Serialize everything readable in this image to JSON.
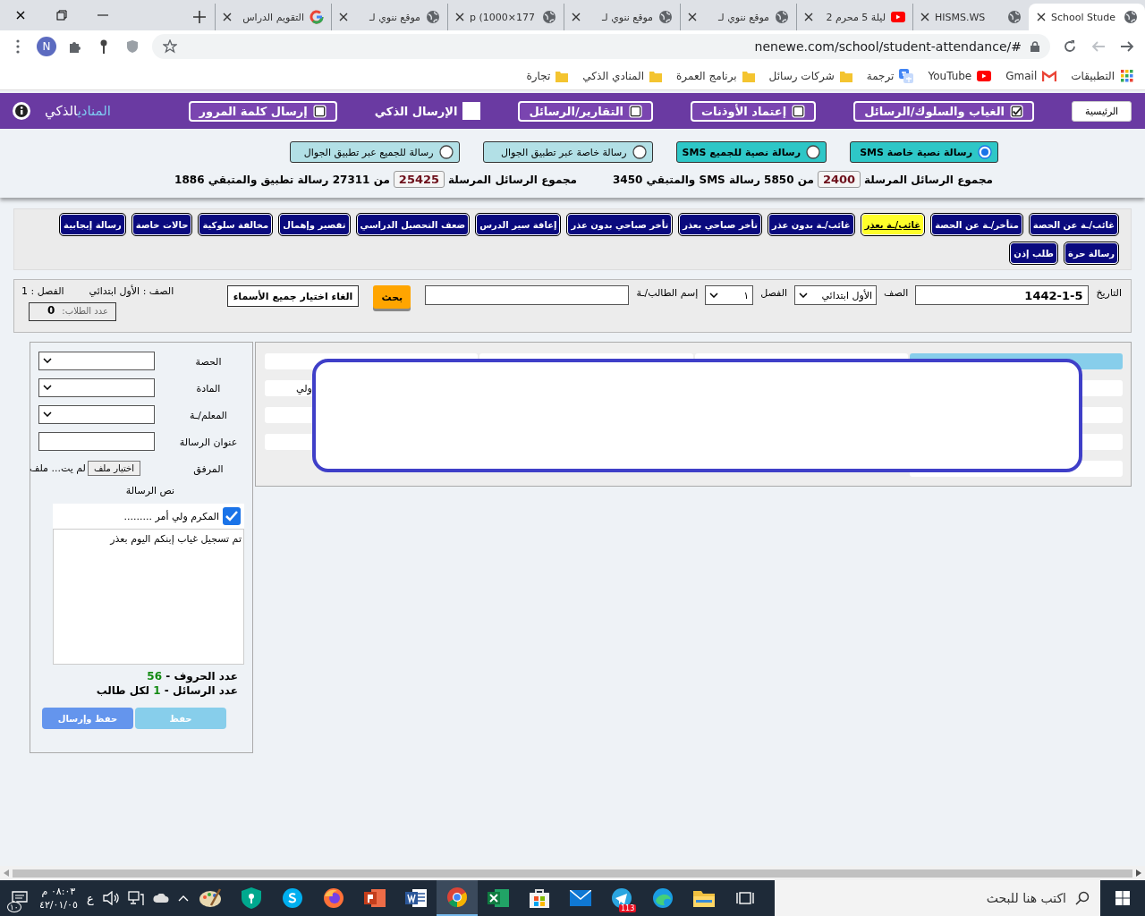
{
  "browser": {
    "tabs": [
      {
        "title": "School Stude",
        "selected": true
      },
      {
        "title": "HISMS.WS",
        "selected": false
      },
      {
        "title": "ليلة 5 محرم 2",
        "selected": false
      },
      {
        "title": "موقع ننوي لـ",
        "selected": false
      },
      {
        "title": "موقع ننوي لـ",
        "selected": false
      },
      {
        "title": "p (1000×177",
        "selected": false
      },
      {
        "title": "موقع ننوي لـ",
        "selected": false
      },
      {
        "title": "التقويم الدراس",
        "selected": false
      }
    ],
    "address": "nenewe.com/school/student-attendance/#",
    "profile_initial": "N",
    "bookmarks": [
      {
        "label": "التطبيقات"
      },
      {
        "label": "Gmail"
      },
      {
        "label": "YouTube"
      },
      {
        "label": "ترجمة"
      },
      {
        "label": "شركات رسائل"
      },
      {
        "label": "برنامج العمرة"
      },
      {
        "label": "المنادي الذكي"
      },
      {
        "label": "تجارة"
      }
    ]
  },
  "nav": {
    "home": "الرئيسية",
    "items": [
      {
        "label": "الغياب والسلوك/الرسائل",
        "kind": "framed",
        "checked": true
      },
      {
        "label": "إعتماد الأوذنات",
        "kind": "framed",
        "checked": false
      },
      {
        "label": "التقارير/الرسائل",
        "kind": "framed",
        "checked": false
      },
      {
        "label": "الإرسال الذكي",
        "kind": "plain",
        "checked": false
      },
      {
        "label": "إرسال كلمة المرور",
        "kind": "framed",
        "checked": false
      }
    ],
    "logo": {
      "first": "المنادي",
      "second": "الذكي"
    }
  },
  "message_types": [
    {
      "label": "رسالة نصية خاصة SMS",
      "kind": "sms",
      "selected": true
    },
    {
      "label": "رسالة نصية للجميع SMS",
      "kind": "sms",
      "selected": false
    },
    {
      "label": "رسالة خاصة عبر تطبيق الجوال",
      "kind": "app",
      "selected": false
    },
    {
      "label": "رسالة للجميع عبر تطبيق الجوال",
      "kind": "app",
      "selected": false
    }
  ],
  "stats": [
    {
      "label": "مجموع الرسائل المرسلة",
      "sent": "2400",
      "rest": "من 5850 رسالة SMS والمتبقي 3450"
    },
    {
      "label": "مجموع الرسائل المرسلة",
      "sent": "25425",
      "rest": "من 27311 رسالة تطبيق والمتبقي 1886"
    }
  ],
  "categories": [
    {
      "label": "غائب/ـة عن الحصة",
      "selected": false
    },
    {
      "label": "متأخر/ـة عن الحصة",
      "selected": false
    },
    {
      "label": "غائب/ـة بعذر",
      "selected": true
    },
    {
      "label": "غائب/ـة بدون عذر",
      "selected": false
    },
    {
      "label": "تأخر صباحي بعذر",
      "selected": false
    },
    {
      "label": "تأخر صباحي بدون عذر",
      "selected": false
    },
    {
      "label": "إعاقة سير الدرس",
      "selected": false
    },
    {
      "label": "ضعف التحصيل الدراسي",
      "selected": false
    },
    {
      "label": "تقصير وإهمال",
      "selected": false
    },
    {
      "label": "مخالفة سلوكية",
      "selected": false
    },
    {
      "label": "حالات خاصة",
      "selected": false
    },
    {
      "label": "رسالة إيجابية",
      "selected": false
    },
    {
      "label": "رسالة حرة",
      "selected": false
    },
    {
      "label": "طلب إذن",
      "selected": false
    }
  ],
  "filters": {
    "date_label": "التاريخ",
    "date": "1442-1-5",
    "grade_label": "الصف",
    "grade": "الأول ابتدائي",
    "class_label": "الفصل",
    "class": "١",
    "student_label": "إسم الطالب/ـة",
    "search_button": "بحث",
    "clear_button": "الغاء اختيار جميع الأسماء",
    "grade_info": "الصف : الأول ابتدائي",
    "class_info": "الفصل : 1",
    "count_label": "عدد الطلاب:",
    "count": "0"
  },
  "table": {
    "rows": [
      {
        "kind": "header"
      },
      {
        "kind": "body",
        "fragment": "ولي"
      },
      {
        "kind": "body"
      },
      {
        "kind": "body"
      },
      {
        "kind": "short"
      }
    ]
  },
  "form": {
    "fields": [
      {
        "label": "الحصة",
        "kind": "select"
      },
      {
        "label": "المادة",
        "kind": "select"
      },
      {
        "label": "المعلم/ـة",
        "kind": "select"
      },
      {
        "label": "عنوان الرسالة",
        "kind": "text"
      },
      {
        "label": "المرفق",
        "kind": "file",
        "button": "اختيار ملف",
        "status": "لم يت... ملف"
      }
    ],
    "body_label": "نص الرسالة",
    "greeting": {
      "label": "المكرم ولي أمر .........",
      "checked": true
    },
    "message": "تم تسجيل غياب إبنكم اليوم بعذر",
    "chars_label": "عدد الحروف -",
    "chars": "56",
    "count_label": "عدد الرسائل -",
    "count": "1",
    "count_suffix": "لكل طالب",
    "buttons": [
      {
        "label": "حفظ",
        "disabled": true
      },
      {
        "label": "حفظ وإرسال",
        "disabled": false
      }
    ]
  },
  "taskbar": {
    "search_placeholder": "اكتب هنا للبحث",
    "apps": [
      {
        "kind": "taskview",
        "selected": false
      },
      {
        "kind": "folder",
        "selected": false
      },
      {
        "kind": "edge",
        "selected": false
      },
      {
        "kind": "telegram",
        "selected": false,
        "badge": "113"
      },
      {
        "kind": "mail",
        "selected": false
      },
      {
        "kind": "store",
        "selected": false
      },
      {
        "kind": "excel",
        "selected": false
      },
      {
        "kind": "chrome",
        "selected": true
      },
      {
        "kind": "word",
        "selected": false
      },
      {
        "kind": "powerpoint",
        "selected": false
      },
      {
        "kind": "firefox",
        "selected": false
      },
      {
        "kind": "skype",
        "selected": false
      },
      {
        "kind": "shield",
        "selected": false
      },
      {
        "kind": "paint",
        "selected": false
      }
    ],
    "tray": {
      "language": "ع",
      "time": "٠٨:٠٣ م",
      "date": "٤٢/٠١/٠٥",
      "notifications": "١٠"
    }
  }
}
